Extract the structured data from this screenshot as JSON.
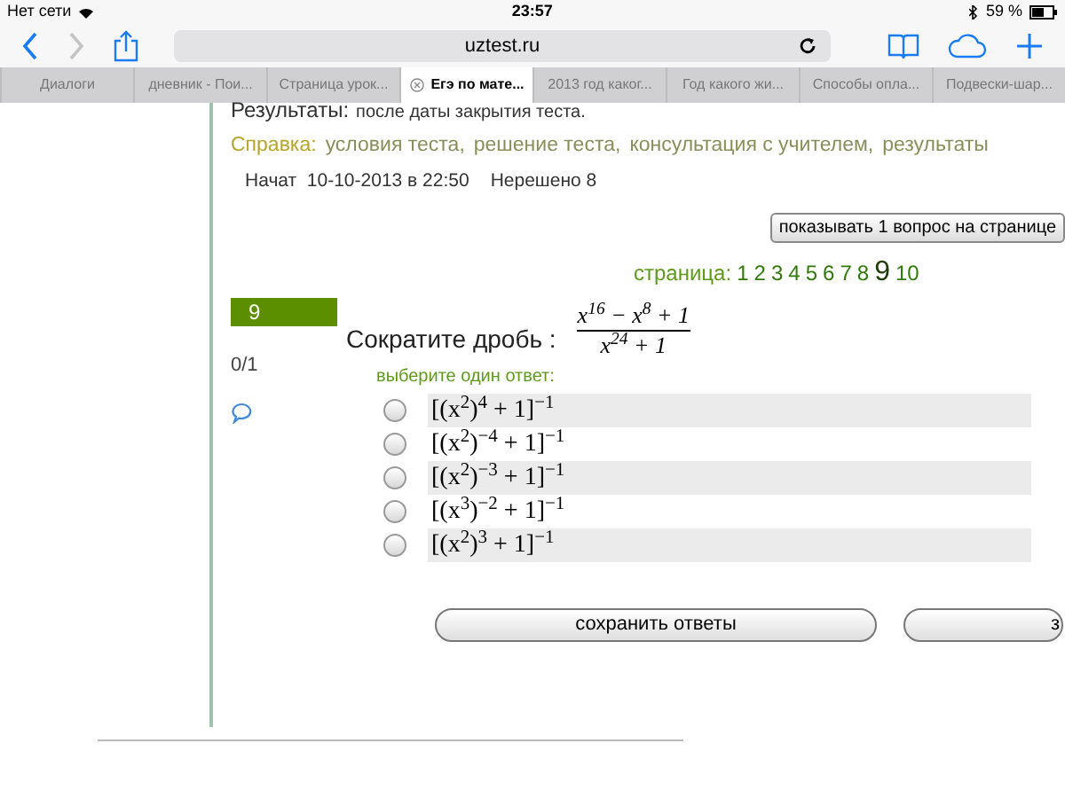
{
  "status_bar": {
    "carrier": "Нет сети",
    "time": "23:57",
    "battery": "59 %"
  },
  "toolbar": {
    "url": "uztest.ru"
  },
  "tabs": [
    {
      "label": "Диалоги",
      "selected": false
    },
    {
      "label": "дневник - Пои...",
      "selected": false
    },
    {
      "label": "Страница урок...",
      "selected": false
    },
    {
      "label": "Егэ по мате...",
      "selected": true
    },
    {
      "label": "2013 год каког...",
      "selected": false
    },
    {
      "label": "Год какого жи...",
      "selected": false
    },
    {
      "label": "Способы опла...",
      "selected": false
    },
    {
      "label": "Подвески-шар...",
      "selected": false
    }
  ],
  "results": {
    "label": "Результаты:",
    "text": "после даты закрытия теста."
  },
  "help": {
    "label": "Справка:",
    "links": [
      "условия теста,",
      "решение теста,",
      "консультация с учителем,",
      "результаты"
    ]
  },
  "started": "Начат  10-10-2013 в 22:50",
  "unsolved": "Нерешено 8",
  "per_page_button": "показывать 1 вопрос на странице",
  "pagination": {
    "label": "страница:",
    "pages": [
      {
        "label": "1",
        "selected": false
      },
      {
        "label": "2",
        "selected": false
      },
      {
        "label": "3",
        "selected": false
      },
      {
        "label": "4",
        "selected": false
      },
      {
        "label": "5",
        "selected": false
      },
      {
        "label": "6",
        "selected": false
      },
      {
        "label": "7",
        "selected": false
      },
      {
        "label": "8",
        "selected": false
      },
      {
        "label": "9",
        "selected": true
      },
      {
        "label": "10",
        "selected": false
      }
    ]
  },
  "question": {
    "number": "9",
    "score": "0/1",
    "prompt": "Сократите дробь :",
    "numerator": "x$^{16}$ − x$^{8}$ + 1",
    "denominator": "x$^{24}$ + 1",
    "instruction": "выберите один ответ:",
    "options": [
      {
        "text": "[(x$^{2}$)$^{4}$ + 1]$^{−1}$",
        "selected": false
      },
      {
        "text": "[(x$^{2}$)$^{−4}$ + 1]$^{−1}$",
        "selected": false
      },
      {
        "text": "[(x$^{2}$)$^{−3}$ + 1]$^{−1}$",
        "selected": false
      },
      {
        "text": "[(x$^{3}$)$^{−2}$ + 1]$^{−1}$",
        "selected": false
      },
      {
        "text": "[(x$^{2}$)$^{3}$ + 1]$^{−1}$",
        "selected": false
      }
    ]
  },
  "buttons": [
    "сохранить ответы",
    "з"
  ]
}
